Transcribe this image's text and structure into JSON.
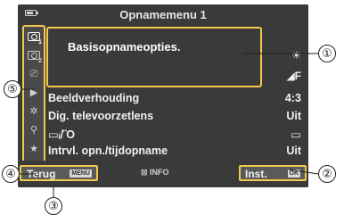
{
  "screen": {
    "title": "Opnamemenu 1",
    "battery_icon": "battery-icon"
  },
  "sidebar": {
    "icons": [
      {
        "name": "shooting-menu-1-icon",
        "glyph": "",
        "sub": "1",
        "active": true
      },
      {
        "name": "shooting-menu-2-icon",
        "glyph": "",
        "sub": "2",
        "active": false
      },
      {
        "name": "video-menu-icon",
        "glyph": "⎚",
        "sub": "",
        "active": false
      },
      {
        "name": "playback-menu-icon",
        "glyph": "▶",
        "sub": "",
        "active": false
      },
      {
        "name": "custom-menu-icon",
        "glyph": "✲",
        "sub": "",
        "active": false
      },
      {
        "name": "setup-menu-icon",
        "glyph": "⚲",
        "sub": "",
        "active": false
      },
      {
        "name": "my-menu-icon",
        "glyph": "★",
        "sub": "",
        "active": false
      }
    ]
  },
  "popup": {
    "text": "Basisopnameopties."
  },
  "right_icons": [
    {
      "name": "white-balance-icon",
      "glyph": "☀"
    },
    {
      "name": "image-quality-icon",
      "glyph": "◢F"
    }
  ],
  "menu": {
    "items": [
      {
        "label": "Beeldverhouding",
        "value": "4:3"
      },
      {
        "label": "Dig. televoorzetlens",
        "value": "Uit"
      },
      {
        "label": "▭ᵢ/Ὃ",
        "value": "▭"
      },
      {
        "label": "Intrvl. opn./tijdopname",
        "value": "Uit"
      }
    ]
  },
  "bottom": {
    "back_label": "Terug",
    "back_key": "MENU",
    "info": "⊠ INFO",
    "set_label": "Inst.",
    "set_key": "OK"
  },
  "callouts": [
    "①",
    "②",
    "③",
    "④",
    "⑤"
  ],
  "colors": {
    "highlight": "#f2c94c",
    "background": "#3a3a3a"
  }
}
